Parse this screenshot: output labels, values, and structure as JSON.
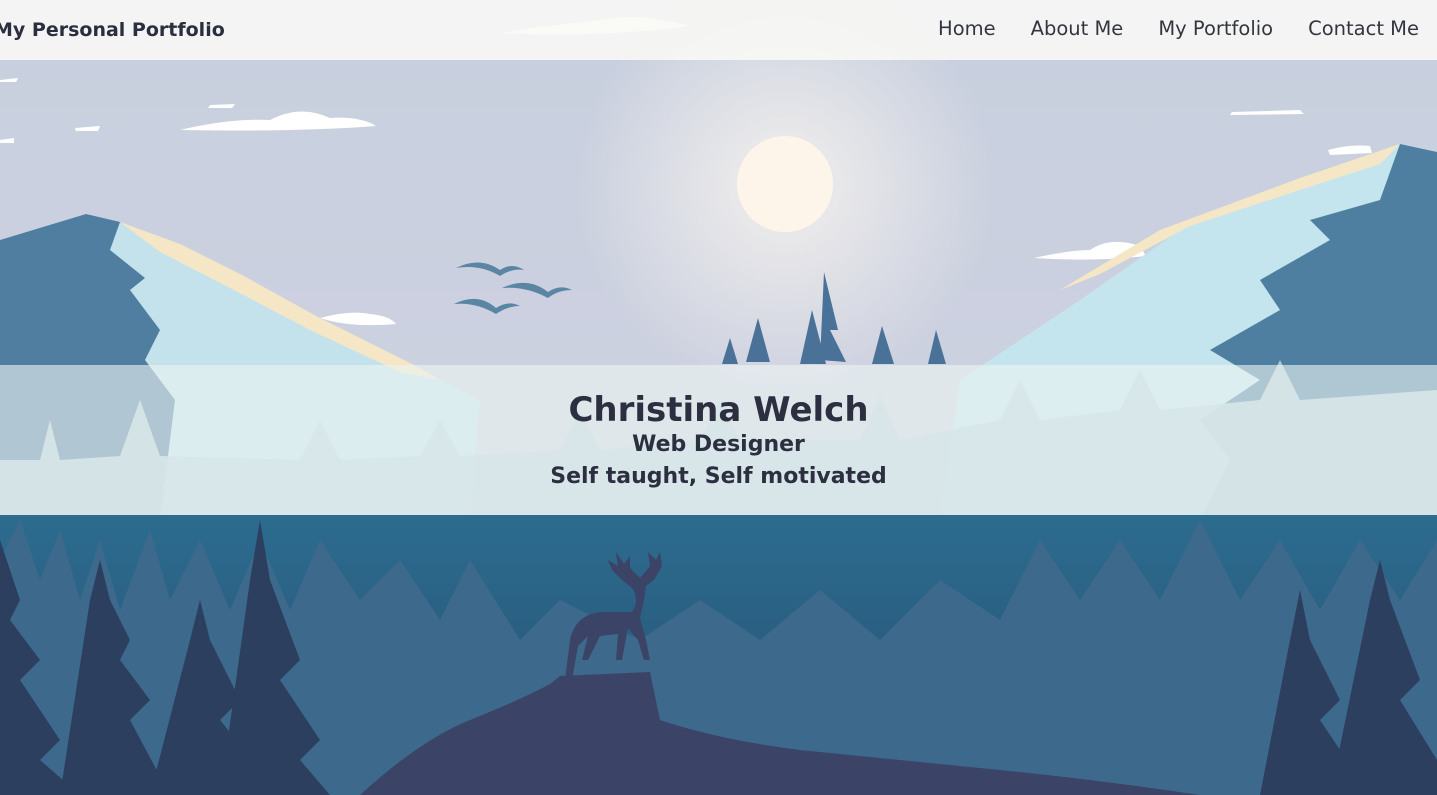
{
  "nav": {
    "brand": "My Personal Portfolio",
    "links": [
      "Home",
      "About Me",
      "My Portfolio",
      "Contact Me"
    ]
  },
  "hero": {
    "name": "Christina Welch",
    "role": "Web Designer",
    "tagline": "Self taught, Self motivated"
  },
  "colors": {
    "sky": "#c9d3e0",
    "sun": "#fff6e8",
    "mountain_light": "#c2e3ee",
    "mountain_dark": "#4e7ea2",
    "forest_blue": "#2f6888",
    "forest_dark": "#3a4669",
    "text": "#2c2f40"
  }
}
